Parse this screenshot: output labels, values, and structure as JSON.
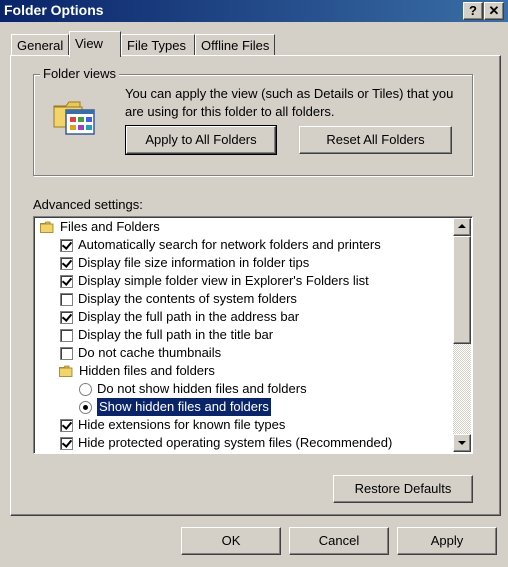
{
  "window": {
    "title": "Folder Options",
    "help_label": "?",
    "close_label": "✕"
  },
  "tabs": [
    {
      "label": "General",
      "active": false
    },
    {
      "label": "View",
      "active": true
    },
    {
      "label": "File Types",
      "active": false
    },
    {
      "label": "Offline Files",
      "active": false
    }
  ],
  "folder_views": {
    "legend": "Folder views",
    "description": "You can apply the view (such as Details or Tiles) that you are using for this folder to all folders.",
    "apply_label": "Apply to All Folders",
    "reset_label": "Reset All Folders",
    "icon": "folder-views-icon"
  },
  "advanced": {
    "label": "Advanced settings:",
    "items": [
      {
        "type": "folder",
        "label": "Files and Folders"
      },
      {
        "type": "checkbox",
        "checked": true,
        "label": "Automatically search for network folders and printers"
      },
      {
        "type": "checkbox",
        "checked": true,
        "label": "Display file size information in folder tips"
      },
      {
        "type": "checkbox",
        "checked": true,
        "label": "Display simple folder view in Explorer's Folders list"
      },
      {
        "type": "checkbox",
        "checked": false,
        "label": "Display the contents of system folders"
      },
      {
        "type": "checkbox",
        "checked": true,
        "label": "Display the full path in the address bar"
      },
      {
        "type": "checkbox",
        "checked": false,
        "label": "Display the full path in the title bar"
      },
      {
        "type": "checkbox",
        "checked": false,
        "label": "Do not cache thumbnails"
      },
      {
        "type": "folder",
        "label": "Hidden files and folders"
      },
      {
        "type": "radio",
        "checked": false,
        "label": "Do not show hidden files and folders"
      },
      {
        "type": "radio",
        "checked": true,
        "selected": true,
        "label": "Show hidden files and folders"
      },
      {
        "type": "checkbox",
        "checked": true,
        "label": "Hide extensions for known file types"
      },
      {
        "type": "checkbox",
        "checked": true,
        "label": "Hide protected operating system files (Recommended)"
      }
    ],
    "restore_label": "Restore Defaults"
  },
  "footer": {
    "ok_label": "OK",
    "cancel_label": "Cancel",
    "apply_label": "Apply"
  },
  "colors": {
    "title_start": "#0a246a",
    "title_end": "#3a6ea5",
    "face": "#d4d0c8",
    "selection": "#0a246a"
  }
}
